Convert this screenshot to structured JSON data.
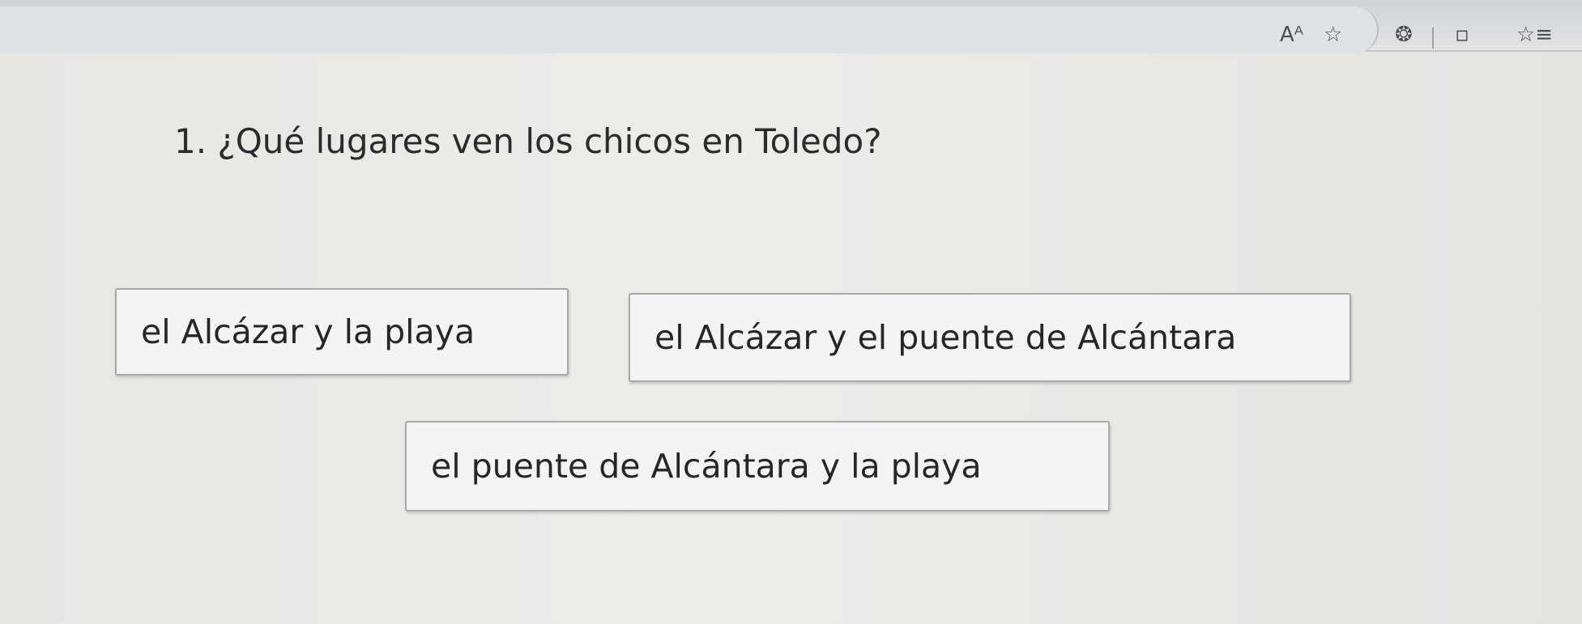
{
  "browser": {
    "icons": [
      "read-aloud-icon",
      "favorite-star-icon",
      "extension-icon",
      "split-screen-icon",
      "favorites-list-icon"
    ],
    "read_aloud_glyph": "Aᴬ",
    "star_glyph": "☆",
    "extension_glyph": "❂",
    "split_glyph": "▫",
    "favorites_glyph": "☆≡"
  },
  "quiz": {
    "question": "1. ¿Qué lugares ven los chicos en Toledo?",
    "options": [
      "el Alcázar y la playa",
      "el Alcázar y el puente de Alcántara",
      "el puente de Alcántara y la playa"
    ]
  }
}
